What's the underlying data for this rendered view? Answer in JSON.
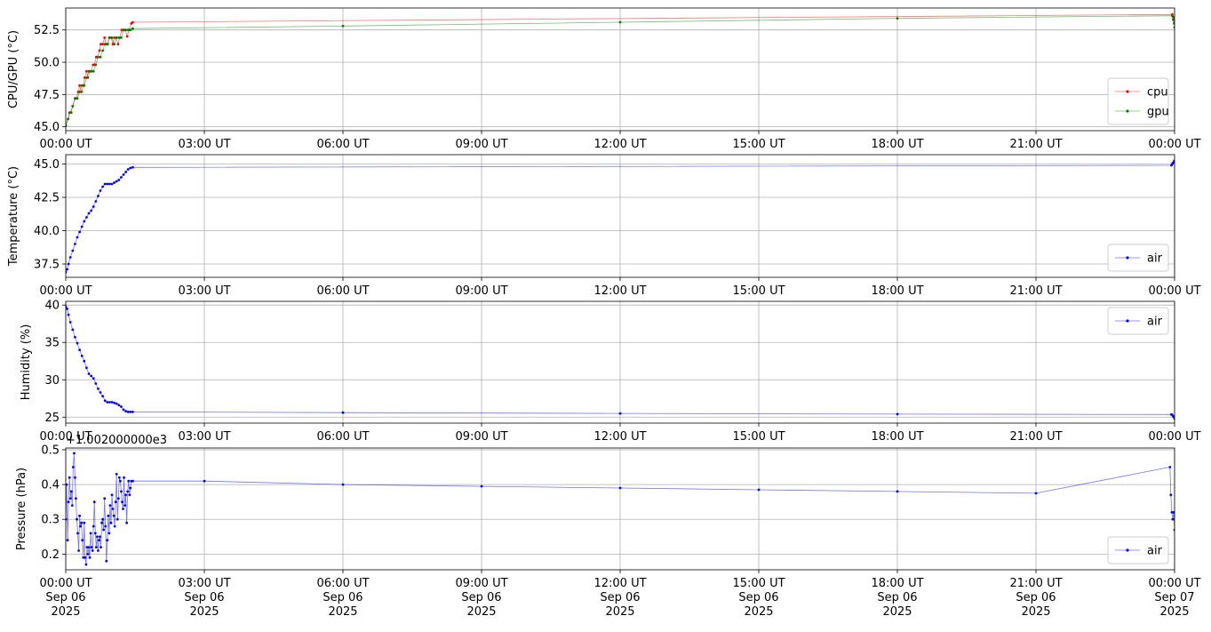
{
  "chart_data": [
    {
      "type": "line",
      "ylabel": "CPU/GPU (°C)",
      "xlim_hours": [
        0,
        24
      ],
      "ylim": [
        44.7,
        54.2
      ],
      "yticks": [
        45.0,
        47.5,
        50.0,
        52.5
      ],
      "ytick_labels": [
        "45.0",
        "47.5",
        "50.0",
        "52.5"
      ],
      "xticks_hours": [
        0,
        3,
        6,
        9,
        12,
        15,
        18,
        21,
        24
      ],
      "xtick_labels": [
        "00:00 UT",
        "03:00 UT",
        "06:00 UT",
        "09:00 UT",
        "12:00 UT",
        "15:00 UT",
        "18:00 UT",
        "21:00 UT",
        "00:00 UT"
      ],
      "grid": true,
      "legend": "lower right",
      "series": [
        {
          "name": "cpu",
          "color": "#ff0000",
          "x": [
            0.0,
            0.05,
            0.08,
            0.12,
            0.15,
            0.2,
            0.23,
            0.27,
            0.3,
            0.34,
            0.38,
            0.41,
            0.45,
            0.48,
            0.52,
            0.55,
            0.59,
            0.62,
            0.66,
            0.69,
            0.73,
            0.76,
            0.8,
            0.84,
            0.87,
            0.91,
            0.94,
            0.98,
            1.02,
            1.05,
            1.09,
            1.13,
            1.17,
            1.21,
            1.25,
            1.29,
            1.33,
            1.37,
            1.42,
            1.45,
            23.95,
            23.97,
            23.99,
            24.0
          ],
          "y": [
            45.1,
            45.6,
            46.1,
            46.1,
            46.6,
            47.2,
            47.2,
            47.7,
            48.2,
            47.7,
            48.2,
            48.8,
            49.3,
            48.8,
            49.3,
            49.3,
            49.8,
            49.8,
            50.4,
            50.4,
            50.9,
            51.4,
            51.4,
            51.9,
            51.4,
            51.4,
            51.9,
            51.9,
            51.4,
            51.9,
            51.9,
            51.4,
            51.9,
            52.5,
            52.5,
            52.5,
            52.0,
            52.5,
            53.0,
            53.1,
            53.7,
            53.5,
            53.3,
            53.1
          ]
        },
        {
          "name": "gpu",
          "color": "#008000",
          "x": [
            0.0,
            0.05,
            0.1,
            0.15,
            0.2,
            0.25,
            0.3,
            0.35,
            0.4,
            0.45,
            0.5,
            0.55,
            0.6,
            0.65,
            0.7,
            0.75,
            0.8,
            0.85,
            0.9,
            0.95,
            1.0,
            1.05,
            1.1,
            1.15,
            1.2,
            1.25,
            1.3,
            1.35,
            1.4,
            1.45,
            6.0,
            12.0,
            18.0,
            23.95,
            23.97,
            23.99,
            24.0
          ],
          "y": [
            45.1,
            45.6,
            46.1,
            46.6,
            47.2,
            47.2,
            47.7,
            48.2,
            48.2,
            48.8,
            49.3,
            49.3,
            49.3,
            49.8,
            50.4,
            50.4,
            50.9,
            51.4,
            51.4,
            51.9,
            51.9,
            51.4,
            51.9,
            51.9,
            51.9,
            52.5,
            52.5,
            52.5,
            52.5,
            52.6,
            52.8,
            53.1,
            53.4,
            53.6,
            53.3,
            53.0,
            52.7
          ]
        }
      ]
    },
    {
      "type": "line",
      "ylabel": "Temperature (°C)",
      "xlim_hours": [
        0,
        24
      ],
      "ylim": [
        36.5,
        45.7
      ],
      "yticks": [
        37.5,
        40.0,
        42.5,
        45.0
      ],
      "ytick_labels": [
        "37.5",
        "40.0",
        "42.5",
        "45.0"
      ],
      "xticks_hours": [
        0,
        3,
        6,
        9,
        12,
        15,
        18,
        21,
        24
      ],
      "xtick_labels": [
        "00:00 UT",
        "03:00 UT",
        "06:00 UT",
        "09:00 UT",
        "12:00 UT",
        "15:00 UT",
        "18:00 UT",
        "21:00 UT",
        "00:00 UT"
      ],
      "grid": true,
      "legend": "lower right",
      "series": [
        {
          "name": "air",
          "color": "#0000ff",
          "x": [
            0.0,
            0.03,
            0.06,
            0.1,
            0.15,
            0.2,
            0.25,
            0.3,
            0.35,
            0.4,
            0.45,
            0.5,
            0.55,
            0.6,
            0.65,
            0.7,
            0.75,
            0.8,
            0.85,
            0.9,
            0.95,
            1.0,
            1.05,
            1.1,
            1.15,
            1.2,
            1.25,
            1.3,
            1.35,
            1.4,
            1.45,
            23.93,
            23.95,
            23.97,
            23.99,
            24.0
          ],
          "y": [
            36.9,
            37.1,
            37.5,
            38.0,
            38.5,
            39.0,
            39.5,
            39.9,
            40.3,
            40.7,
            41.0,
            41.3,
            41.5,
            41.8,
            42.2,
            42.6,
            43.0,
            43.3,
            43.5,
            43.5,
            43.5,
            43.5,
            43.6,
            43.7,
            43.8,
            44.0,
            44.2,
            44.4,
            44.6,
            44.7,
            44.75,
            44.9,
            45.0,
            45.1,
            45.2,
            45.25
          ]
        }
      ]
    },
    {
      "type": "line",
      "ylabel": "Humidity (%)",
      "xlim_hours": [
        0,
        24
      ],
      "ylim": [
        24.2,
        40.5
      ],
      "yticks": [
        25,
        30,
        35,
        40
      ],
      "ytick_labels": [
        "25",
        "30",
        "35",
        "40"
      ],
      "xticks_hours": [
        0,
        3,
        6,
        9,
        12,
        15,
        18,
        21,
        24
      ],
      "xtick_labels": [
        "00:00 UT",
        "03:00 UT",
        "06:00 UT",
        "09:00 UT",
        "12:00 UT",
        "15:00 UT",
        "18:00 UT",
        "21:00 UT",
        "00:00 UT"
      ],
      "grid": true,
      "legend": "upper right",
      "series": [
        {
          "name": "air",
          "color": "#0000ff",
          "x": [
            0.0,
            0.03,
            0.06,
            0.1,
            0.15,
            0.2,
            0.25,
            0.3,
            0.35,
            0.4,
            0.45,
            0.5,
            0.55,
            0.6,
            0.65,
            0.7,
            0.75,
            0.8,
            0.85,
            0.9,
            0.95,
            1.0,
            1.05,
            1.1,
            1.15,
            1.2,
            1.25,
            1.3,
            1.35,
            1.4,
            1.45,
            6.0,
            12.0,
            18.0,
            23.93,
            23.95,
            23.97,
            23.99,
            24.0
          ],
          "y": [
            39.8,
            39.5,
            38.7,
            37.7,
            36.7,
            35.7,
            34.9,
            34.0,
            33.2,
            32.5,
            31.6,
            30.8,
            30.5,
            30.2,
            29.5,
            28.8,
            28.3,
            27.8,
            27.2,
            27.0,
            27.0,
            27.0,
            26.9,
            26.8,
            26.6,
            26.4,
            26.0,
            25.8,
            25.7,
            25.7,
            25.7,
            25.6,
            25.5,
            25.4,
            25.35,
            25.3,
            25.1,
            25.0,
            24.8
          ]
        }
      ]
    },
    {
      "type": "line",
      "ylabel": "Pressure (hPa)",
      "offset_label": "+1.002000000e3",
      "xlim_hours": [
        0,
        24
      ],
      "ylim": [
        0.155,
        0.505
      ],
      "yticks": [
        0.2,
        0.3,
        0.4,
        0.5
      ],
      "ytick_labels": [
        "0.2",
        "0.3",
        "0.4",
        "0.5"
      ],
      "xticks_hours": [
        0,
        3,
        6,
        9,
        12,
        15,
        18,
        21,
        24
      ],
      "xtick_labels": [
        "00:00 UT\nSep 06\n2025",
        "03:00 UT\nSep 06\n2025",
        "06:00 UT\nSep 06\n2025",
        "09:00 UT\nSep 06\n2025",
        "12:00 UT\nSep 06\n2025",
        "15:00 UT\nSep 06\n2025",
        "18:00 UT\nSep 06\n2025",
        "21:00 UT\nSep 06\n2025",
        "00:00 UT\nSep 07\n2025"
      ],
      "grid": true,
      "legend": "lower right",
      "series": [
        {
          "name": "air",
          "color": "#0000ff",
          "x": [
            0.0,
            0.02,
            0.04,
            0.06,
            0.08,
            0.1,
            0.12,
            0.14,
            0.16,
            0.18,
            0.2,
            0.22,
            0.24,
            0.26,
            0.28,
            0.3,
            0.32,
            0.34,
            0.36,
            0.38,
            0.4,
            0.42,
            0.44,
            0.46,
            0.48,
            0.5,
            0.52,
            0.54,
            0.56,
            0.58,
            0.6,
            0.62,
            0.64,
            0.66,
            0.68,
            0.7,
            0.72,
            0.74,
            0.76,
            0.78,
            0.8,
            0.82,
            0.84,
            0.86,
            0.88,
            0.9,
            0.92,
            0.94,
            0.96,
            0.98,
            1.0,
            1.02,
            1.04,
            1.06,
            1.08,
            1.1,
            1.12,
            1.14,
            1.16,
            1.18,
            1.2,
            1.22,
            1.24,
            1.26,
            1.28,
            1.3,
            1.32,
            1.34,
            1.36,
            1.38,
            1.4,
            1.42,
            1.45,
            3.0,
            6.0,
            9.0,
            12.0,
            15.0,
            18.0,
            21.0,
            23.9,
            23.92,
            23.94,
            23.96,
            23.98,
            24.0
          ],
          "y": [
            0.3,
            0.4,
            0.24,
            0.35,
            0.42,
            0.36,
            0.38,
            0.34,
            0.45,
            0.49,
            0.42,
            0.36,
            0.3,
            0.26,
            0.21,
            0.31,
            0.28,
            0.29,
            0.24,
            0.19,
            0.29,
            0.19,
            0.17,
            0.22,
            0.2,
            0.22,
            0.19,
            0.26,
            0.22,
            0.21,
            0.28,
            0.35,
            0.26,
            0.22,
            0.25,
            0.21,
            0.24,
            0.25,
            0.22,
            0.29,
            0.3,
            0.27,
            0.36,
            0.28,
            0.18,
            0.24,
            0.31,
            0.26,
            0.34,
            0.29,
            0.37,
            0.33,
            0.31,
            0.28,
            0.35,
            0.43,
            0.3,
            0.36,
            0.42,
            0.41,
            0.38,
            0.35,
            0.33,
            0.42,
            0.34,
            0.37,
            0.29,
            0.38,
            0.41,
            0.37,
            0.39,
            0.41,
            0.41,
            0.41,
            0.4,
            0.395,
            0.39,
            0.385,
            0.38,
            0.375,
            0.45,
            0.37,
            0.32,
            0.3,
            0.32,
            0.27
          ]
        }
      ]
    }
  ]
}
